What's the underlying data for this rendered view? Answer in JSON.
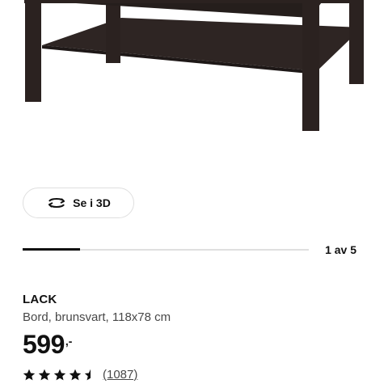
{
  "product_image": {
    "icon": "coffee-table-image",
    "wood_color": "#2b2220"
  },
  "view_3d": {
    "label": "Se i 3D",
    "icon": "rotate-3d-icon"
  },
  "carousel": {
    "counter": "1 av 5",
    "current": 1,
    "total": 5,
    "progress": 0.2
  },
  "product": {
    "name": "LACK",
    "description": "Bord, brunsvart, 118x78 cm",
    "price": "599",
    "price_suffix": ",-",
    "rating": 4.5,
    "rating_max": 5,
    "review_count": "(1087)"
  },
  "colors": {
    "text": "#111111",
    "muted": "#484848",
    "track": "#dfdfdf"
  }
}
